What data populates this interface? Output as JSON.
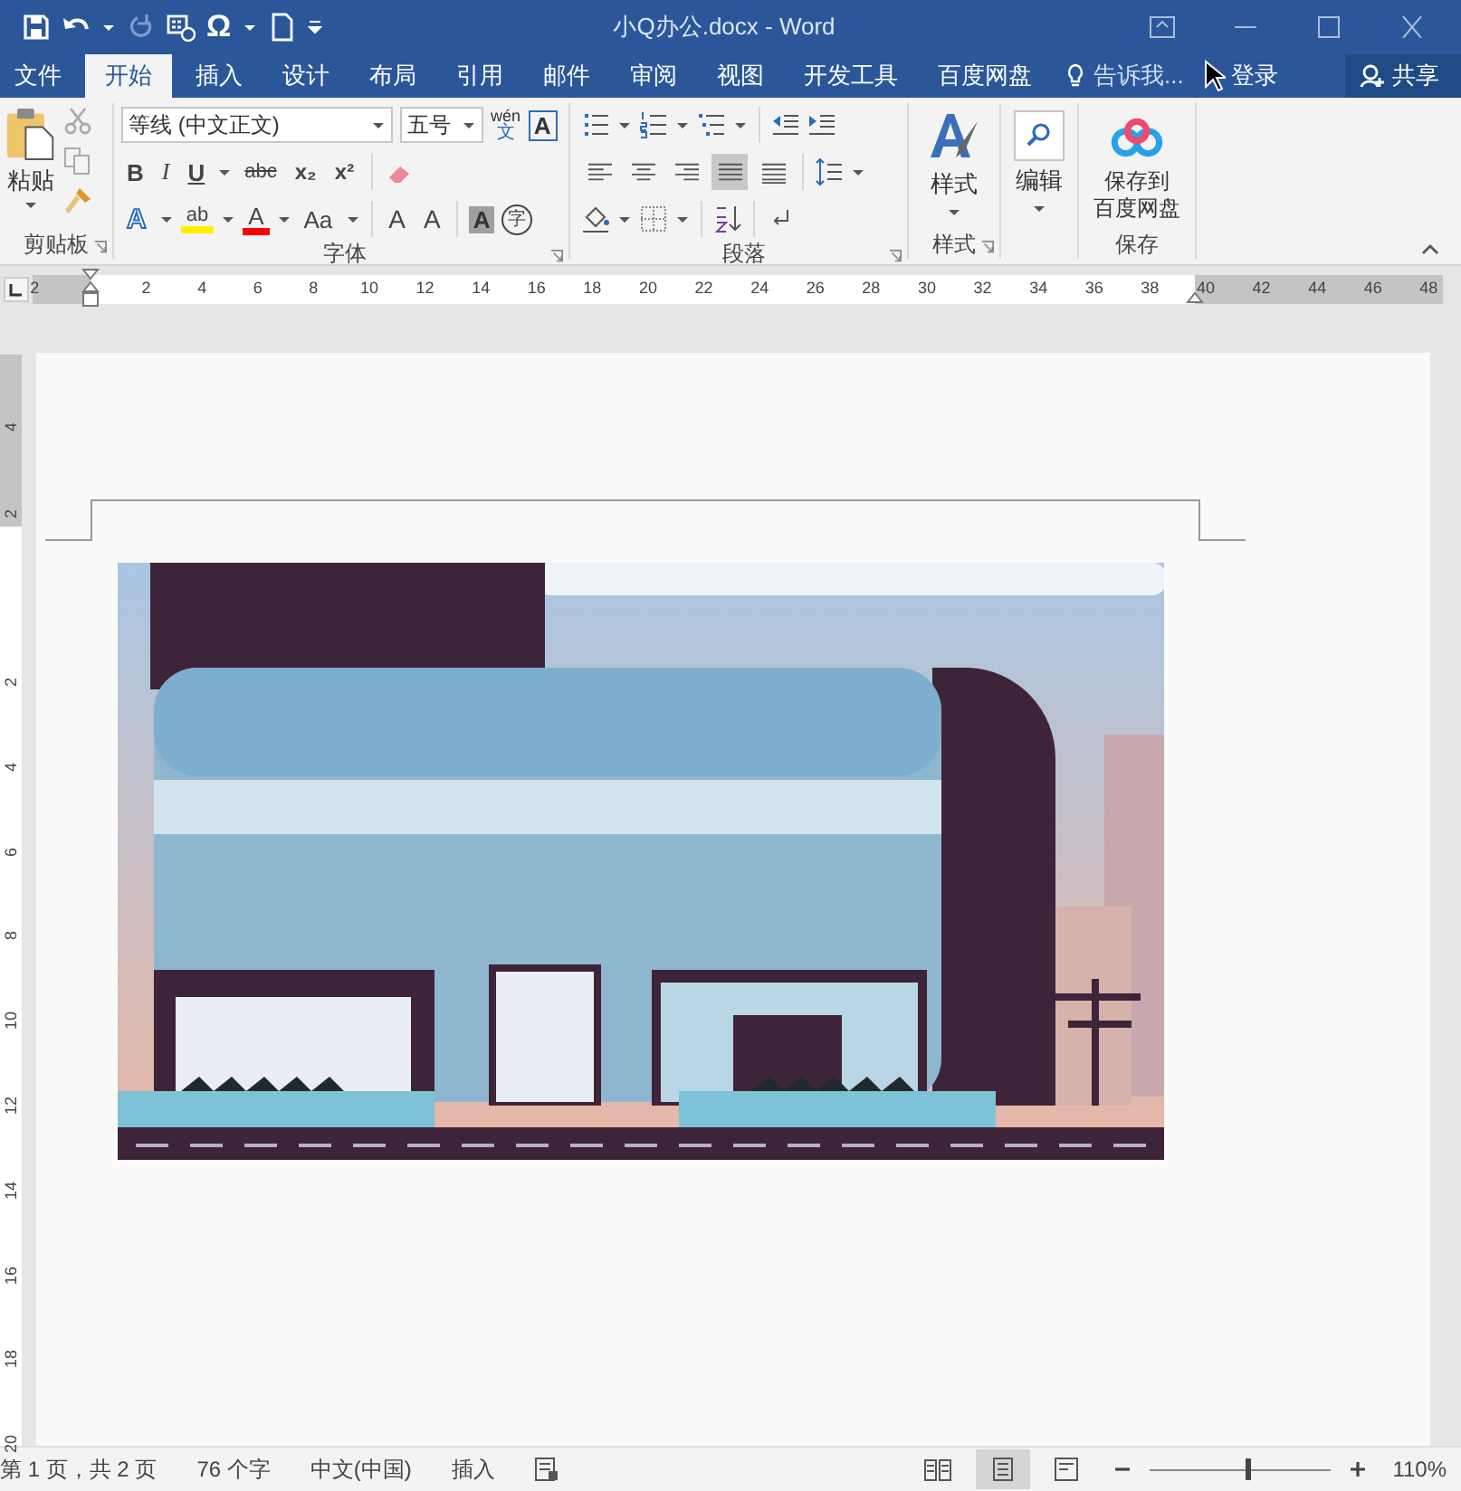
{
  "window": {
    "title": "小Q办公.docx - Word"
  },
  "quick_access": {
    "symbol": "Ω"
  },
  "tabs": [
    {
      "label": "文件",
      "selected": false
    },
    {
      "label": "开始",
      "selected": true
    },
    {
      "label": "插入",
      "selected": false
    },
    {
      "label": "设计",
      "selected": false
    },
    {
      "label": "布局",
      "selected": false
    },
    {
      "label": "引用",
      "selected": false
    },
    {
      "label": "邮件",
      "selected": false
    },
    {
      "label": "审阅",
      "selected": false
    },
    {
      "label": "视图",
      "selected": false
    },
    {
      "label": "开发工具",
      "selected": false
    },
    {
      "label": "百度网盘",
      "selected": false
    }
  ],
  "tell_me": "告诉我...",
  "sign_in": "登录",
  "share": "共享",
  "clipboard": {
    "paste": "粘贴",
    "label": "剪贴板"
  },
  "font": {
    "font_name": "等线 (中文正文)",
    "font_size": "五号",
    "phonetic_top": "wén",
    "phonetic_bottom": "文",
    "border_char": "A",
    "bold": "B",
    "italic": "I",
    "underline": "U",
    "strike": "abc",
    "subscript": "x₂",
    "superscript": "x²",
    "effects": "A",
    "highlight": "ab",
    "font_color_letter": "A",
    "case": "Aa",
    "grow": "A",
    "shrink": "A",
    "shading": "A",
    "enclose": "字",
    "label": "字体"
  },
  "paragraph": {
    "label": "段落",
    "alignments": [
      {
        "selected": false
      },
      {
        "selected": false
      },
      {
        "selected": false
      },
      {
        "selected": true
      },
      {
        "selected": false
      }
    ]
  },
  "styles": {
    "button": "样式",
    "label": "样式"
  },
  "editing": {
    "button": "编辑"
  },
  "save": {
    "button_line1": "保存到",
    "button_line2": "百度网盘",
    "label": "保存"
  },
  "ruler": {
    "labels": [
      "2",
      "2",
      "4",
      "6",
      "8",
      "10",
      "12",
      "14",
      "16",
      "18",
      "20",
      "22",
      "24",
      "26",
      "28",
      "30",
      "32",
      "34",
      "36",
      "38",
      "40",
      "42",
      "44",
      "46",
      "48"
    ]
  },
  "vertical_ruler": {
    "labels": [
      "4",
      "2",
      "2",
      "4",
      "6",
      "8",
      "10",
      "12",
      "14",
      "16",
      "18",
      "20"
    ]
  },
  "status_bar": {
    "page": "第 1 页，共 2 页",
    "words": "76 个字",
    "language": "中文(中国)",
    "mode": "插入",
    "views": [
      {
        "selected": false
      },
      {
        "selected": true
      },
      {
        "selected": false
      }
    ],
    "zoom": {
      "level": 0.54
    },
    "zoom_text": "110%"
  }
}
